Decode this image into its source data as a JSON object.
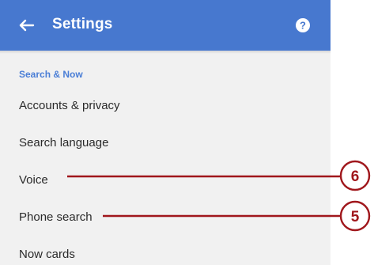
{
  "appbar": {
    "title": "Settings",
    "back_icon": "arrow-back-icon",
    "help_icon": "help-circle-icon",
    "color": "#4778cf"
  },
  "section": {
    "header": "Search & Now",
    "header_color": "#4a7ed6"
  },
  "items": [
    {
      "label": "Accounts & privacy"
    },
    {
      "label": "Search language"
    },
    {
      "label": "Voice"
    },
    {
      "label": "Phone search"
    },
    {
      "label": "Now cards"
    }
  ],
  "callouts": [
    {
      "number": "6",
      "points_to": "Voice"
    },
    {
      "number": "5",
      "points_to": "Phone search"
    }
  ],
  "callout_color": "#a0171c"
}
